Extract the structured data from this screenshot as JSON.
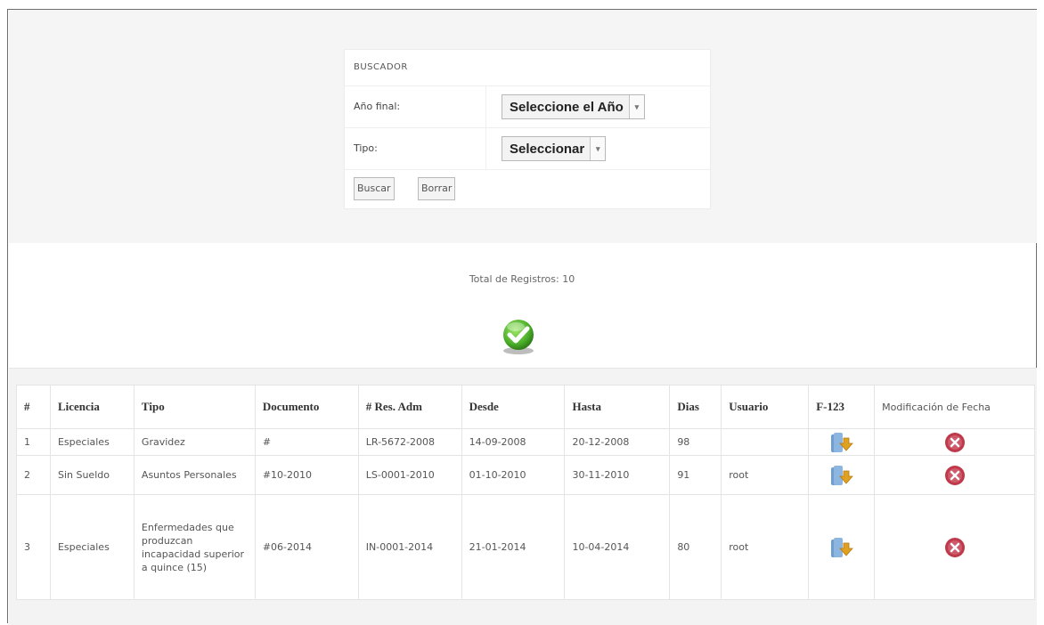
{
  "search": {
    "title": "BUSCADOR",
    "year_label": "Año final:",
    "year_value": "Seleccione el Año",
    "type_label": "Tipo:",
    "type_value": "Seleccionar",
    "search_button": "Buscar",
    "clear_button": "Borrar"
  },
  "total_text": "Total de Registros: 10",
  "table": {
    "headers": [
      "#",
      "Licencia",
      "Tipo",
      "Documento",
      "# Res. Adm",
      "Desde",
      "Hasta",
      "Dias",
      "Usuario",
      "F-123",
      "Modificación de Fecha"
    ],
    "rows": [
      {
        "n": "1",
        "licencia": "Especiales",
        "tipo": "Gravidez",
        "documento": "#",
        "res": "LR-5672-2008",
        "desde": "14-09-2008",
        "hasta": "20-12-2008",
        "dias": "98",
        "usuario": ""
      },
      {
        "n": "2",
        "licencia": "Sin Sueldo",
        "tipo": "Asuntos Personales",
        "documento": "#10-2010",
        "res": "LS-0001-2010",
        "desde": "01-10-2010",
        "hasta": "30-11-2010",
        "dias": "91",
        "usuario": "root"
      },
      {
        "n": "3",
        "licencia": "Especiales",
        "tipo": "Enfermedades que produzcan incapacidad superior a quince (15)",
        "documento": "#06-2014",
        "res": "IN-0001-2014",
        "desde": "21-01-2014",
        "hasta": "10-04-2014",
        "dias": "80",
        "usuario": "root"
      }
    ]
  },
  "colors": {
    "check_green": "#4caf2a",
    "delete_red": "#c0394b",
    "folder_blue": "#6e9fd0",
    "arrow_orange": "#e0a020"
  }
}
